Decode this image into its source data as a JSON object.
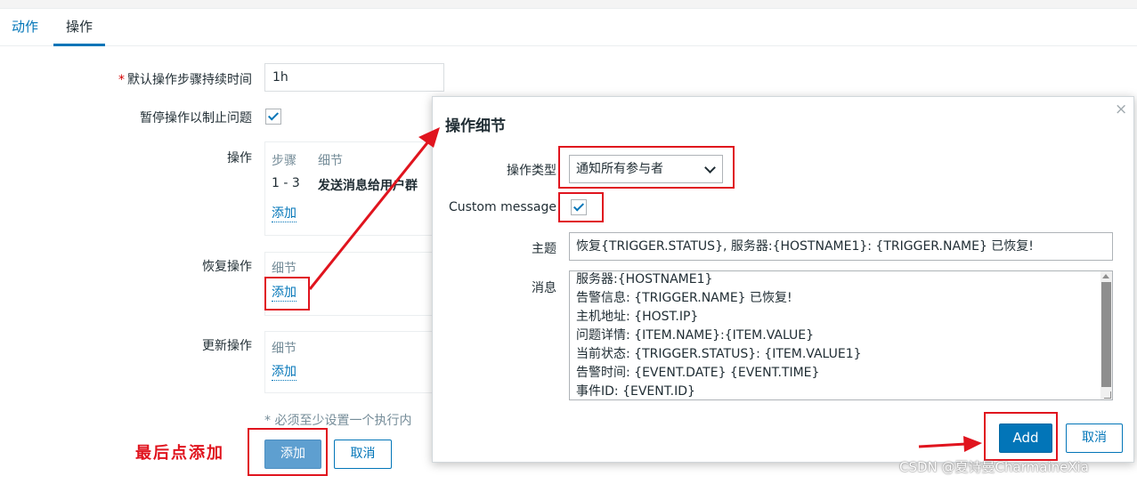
{
  "tabs": [
    "动作",
    "操作"
  ],
  "form": {
    "default_duration": {
      "label": "默认操作步骤持续时间",
      "required_mark": "*",
      "value": "1h"
    },
    "pause_label": "暂停操作以制止问题",
    "operations": {
      "label": "操作",
      "headers": [
        "步骤",
        "细节"
      ],
      "row": {
        "steps": "1 - 3",
        "detail": "发送消息给用户群"
      },
      "add_link": "添加"
    },
    "recovery": {
      "label": "恢复操作",
      "header": "细节",
      "add_link": "添加"
    },
    "update": {
      "label": "更新操作",
      "header": "细节",
      "add_link": "添加"
    },
    "note": "* 必须至少设置一个执行内",
    "add_button": "添加",
    "cancel_button": "取消"
  },
  "annotation": "最后点添加",
  "modal": {
    "title": "操作细节",
    "close": "×",
    "operation_type": {
      "label": "操作类型",
      "value": "通知所有参与者"
    },
    "custom_message_label": "Custom message",
    "subject": {
      "label": "主题",
      "value": "恢复{TRIGGER.STATUS}, 服务器:{HOSTNAME1}: {TRIGGER.NAME} 已恢复!"
    },
    "message": {
      "label": "消息",
      "lines": [
        "服务器:{HOSTNAME1}",
        "告警信息: {TRIGGER.NAME} 已恢复!",
        "主机地址: {HOST.IP}",
        "问题详情: {ITEM.NAME}:{ITEM.VALUE}",
        "当前状态: {TRIGGER.STATUS}: {ITEM.VALUE1}",
        "告警时间: {EVENT.DATE} {EVENT.TIME}",
        "事件ID: {EVENT.ID}"
      ]
    },
    "add_button": "Add",
    "cancel_button": "取消"
  },
  "watermark": "CSDN @夏诗曼CharmaineXia",
  "colors": {
    "accent": "#0275b8",
    "annotation_red": "#e0141e"
  }
}
